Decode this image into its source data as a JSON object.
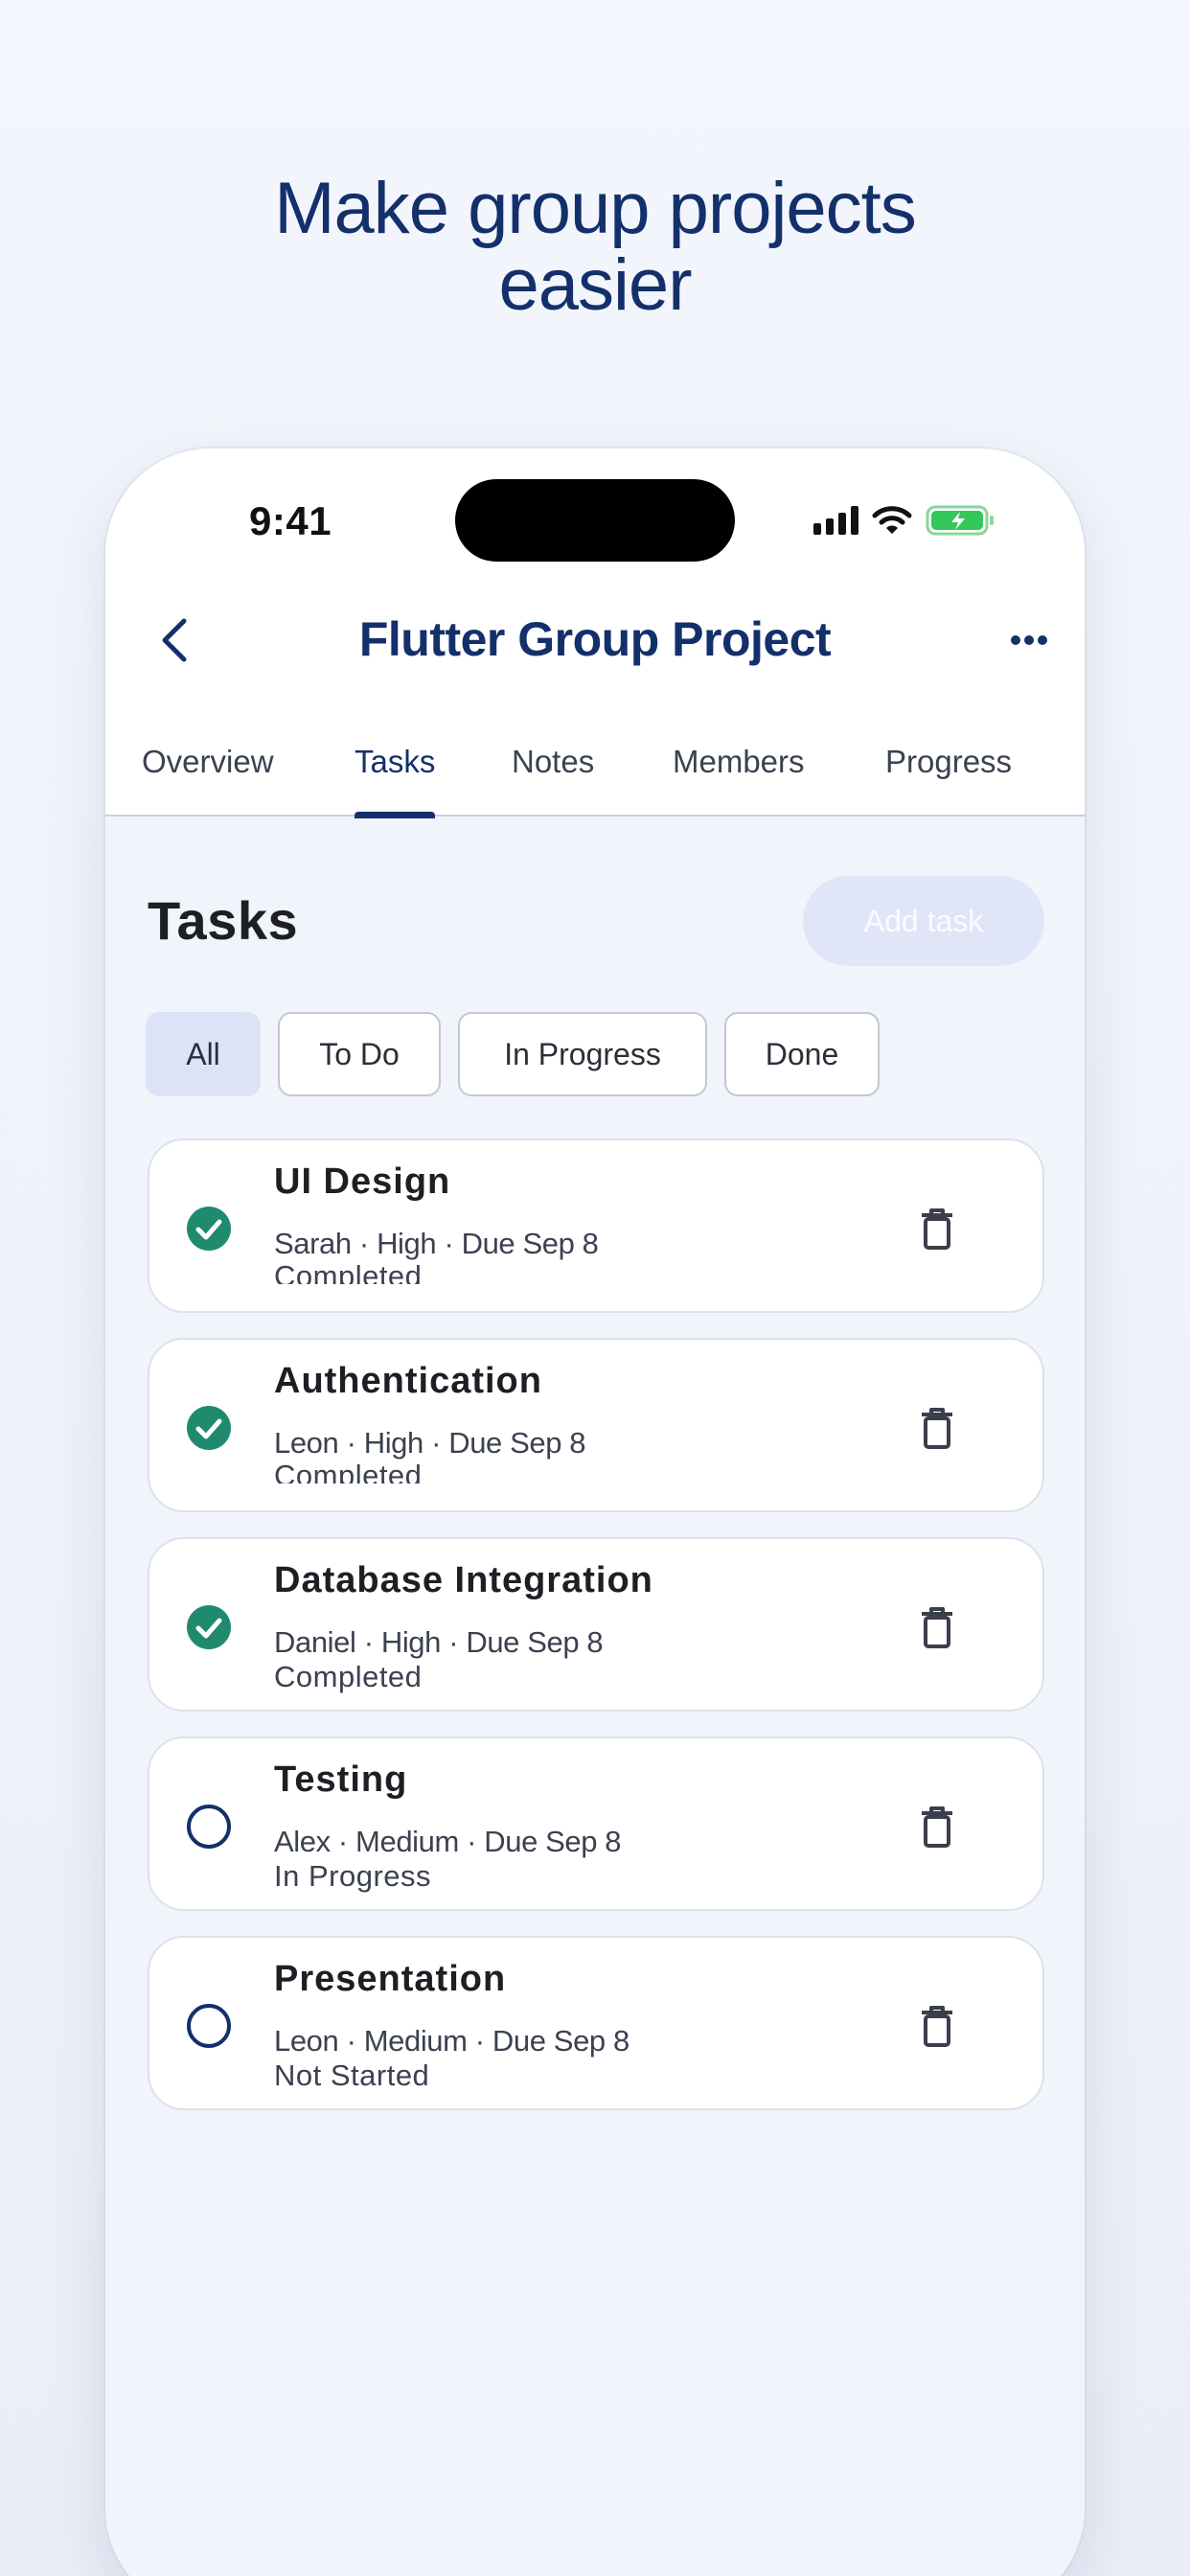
{
  "headline": {
    "line1": "Make group projects",
    "line2": "easier"
  },
  "status_bar": {
    "time": "9:41"
  },
  "nav": {
    "title": "Flutter Group Project"
  },
  "tabs": [
    {
      "label": "Overview"
    },
    {
      "label": "Tasks",
      "active": true
    },
    {
      "label": "Notes"
    },
    {
      "label": "Members"
    },
    {
      "label": "Progress"
    }
  ],
  "section": {
    "title": "Tasks",
    "add_button": "Add task"
  },
  "filters": [
    {
      "label": "All",
      "active": true
    },
    {
      "label": "To Do"
    },
    {
      "label": "In Progress"
    },
    {
      "label": "Done"
    }
  ],
  "tasks": [
    {
      "title": "UI Design",
      "meta": "Sarah · High · Due Sep 8",
      "status": "Completed",
      "done": true
    },
    {
      "title": "Authentication",
      "meta": "Leon · High · Due Sep 8",
      "status": "Completed",
      "done": true
    },
    {
      "title": "Database Integration",
      "meta": "Daniel · High · Due Sep 8",
      "status": "Completed",
      "done": true
    },
    {
      "title": "Testing",
      "meta": "Alex · Medium · Due Sep 8",
      "status": "In Progress",
      "done": false
    },
    {
      "title": "Presentation",
      "meta": "Leon · Medium · Due Sep 8",
      "status": "Not Started",
      "done": false
    }
  ],
  "colors": {
    "primary": "#14306b",
    "check_done": "#1f8a6e",
    "battery": "#34c759"
  },
  "icons": {
    "back": "chevron-left-icon",
    "more": "more-horizontal-icon",
    "done": "check-circle-icon",
    "pending": "circle-outline-icon",
    "delete": "trash-icon"
  }
}
